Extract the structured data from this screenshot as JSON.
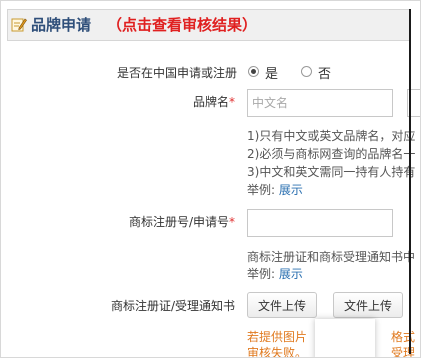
{
  "header": {
    "title": "品牌申请",
    "link": "（点击查看审核结果）",
    "icon": "edit-icon"
  },
  "form": {
    "registered_in_china": {
      "label": "是否在中国申请或注册",
      "options": [
        "是",
        "否"
      ],
      "selected": "是"
    },
    "brand_name": {
      "label": "品牌名",
      "required_mark": "*",
      "placeholder": "中文名",
      "hints": [
        "1)只有中文或英文品牌名，对应",
        "2)必须与商标网查询的品牌名一",
        "3)中文和英文需同一持有人持有"
      ],
      "example_prefix": "举例:",
      "example_link": "展示"
    },
    "trademark_number": {
      "label": "商标注册号/申请号",
      "required_mark": "*",
      "value": "",
      "hint": "商标注册证和商标受理通知书中",
      "example_prefix": "举例:",
      "example_link": "展示"
    },
    "trademark_certificate": {
      "label": "商标注册证/受理通知书",
      "upload_button_1": "文件上传",
      "upload_button_2": "文件上传",
      "warning_line_1_left": "若提供图片",
      "warning_line_1_right": "格式",
      "warning_line_2_left": "审核失败。",
      "warning_line_2_right": "受理"
    }
  },
  "colors": {
    "header_title": "#2f4f7a",
    "header_link": "#e02020",
    "required": "#e03030",
    "link": "#2a6fb0",
    "warning": "#e07a20"
  }
}
